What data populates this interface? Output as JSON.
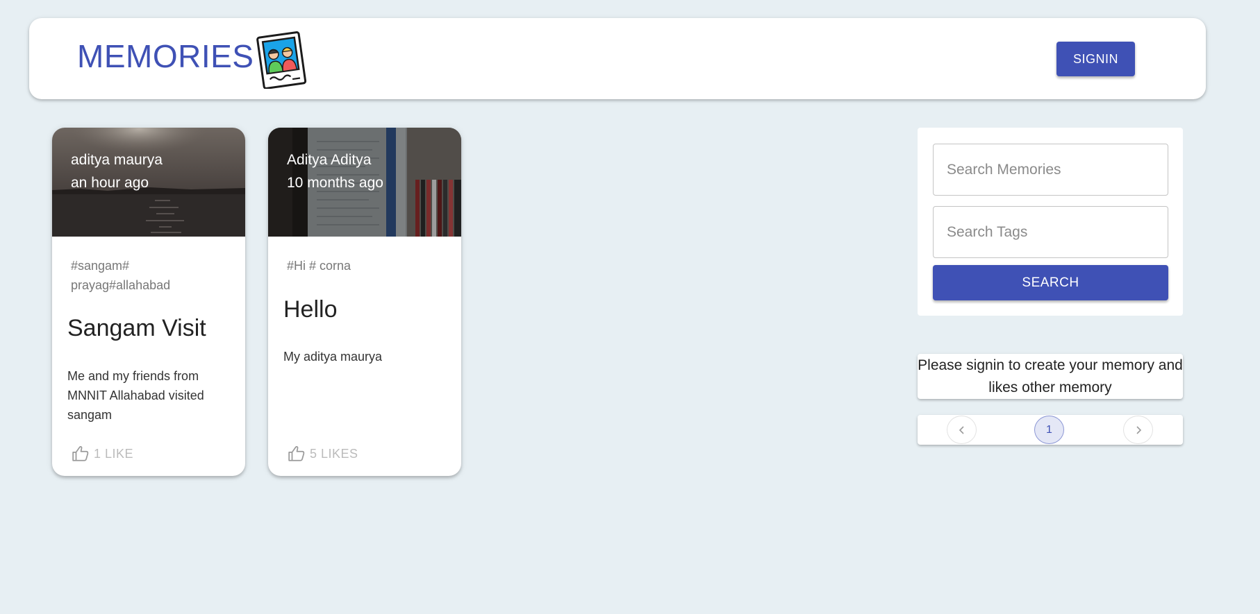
{
  "header": {
    "brand": "MEMORIES",
    "logo_icon": "photo-frame-friends-icon",
    "signin_label": "SIGNIN",
    "accent_color": "#3f51b5"
  },
  "posts": [
    {
      "author": "aditya maurya",
      "time": "an hour ago",
      "tags": "#sangam# prayag#allahabad",
      "title": "Sangam Visit",
      "message": "Me and my friends from MNNIT Allahabad visited sangam",
      "likes_label": "1 LIKE",
      "image": "river-sunset-photo"
    },
    {
      "author": "Aditya Aditya",
      "time": "10 months ago",
      "tags": "#Hi # corna",
      "title": "Hello",
      "message": "My aditya maurya",
      "likes_label": "5 LIKES",
      "image": "room-shelf-photo"
    }
  ],
  "search": {
    "memories_placeholder": "Search Memories",
    "tags_placeholder": "Search Tags",
    "button_label": "SEARCH"
  },
  "notice": "Please signin to create your memory and likes other memory",
  "pagination": {
    "current_page": "1",
    "prev_icon": "chevron-left-icon",
    "next_icon": "chevron-right-icon"
  }
}
